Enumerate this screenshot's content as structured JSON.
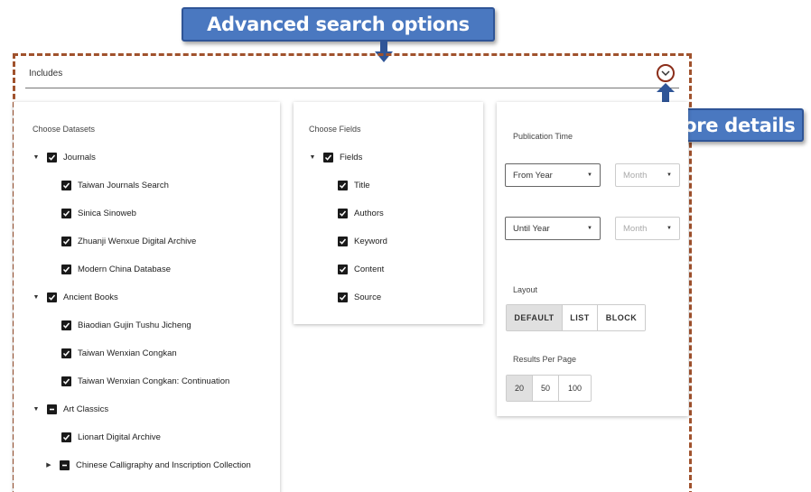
{
  "callouts": {
    "top": "Advanced search options",
    "right": "More details"
  },
  "includes": {
    "label": "Includes"
  },
  "datasets": {
    "title": "Choose Datasets",
    "groups": [
      {
        "label": "Journals",
        "expanded": true,
        "state": "checked",
        "children": [
          "Taiwan Journals Search",
          "Sinica Sinoweb",
          "Zhuanji Wenxue Digital Archive",
          "Modern China Database"
        ]
      },
      {
        "label": "Ancient Books",
        "expanded": true,
        "state": "checked",
        "children": [
          "Biaodian Gujin Tushu Jicheng",
          "Taiwan Wenxian Congkan",
          "Taiwan Wenxian Congkan: Continuation"
        ]
      },
      {
        "label": "Art Classics",
        "expanded": true,
        "state": "indeterminate",
        "children": [
          "Lionart Digital Archive"
        ],
        "subgroup": {
          "label": "Chinese Calligraphy and Inscription Collection",
          "expanded": false,
          "state": "indeterminate"
        }
      }
    ]
  },
  "fields": {
    "title": "Choose Fields",
    "group": "Fields",
    "items": [
      "Title",
      "Authors",
      "Keyword",
      "Content",
      "Source"
    ]
  },
  "options": {
    "publication_time": {
      "title": "Publication Time",
      "from_year": "From Year",
      "from_month": "Month",
      "until_year": "Until Year",
      "until_month": "Month"
    },
    "layout": {
      "title": "Layout",
      "options": [
        "DEFAULT",
        "LIST",
        "BLOCK"
      ],
      "selected": "DEFAULT"
    },
    "results_per_page": {
      "title": "Results Per Page",
      "options": [
        "20",
        "50",
        "100"
      ],
      "selected": "20"
    }
  }
}
